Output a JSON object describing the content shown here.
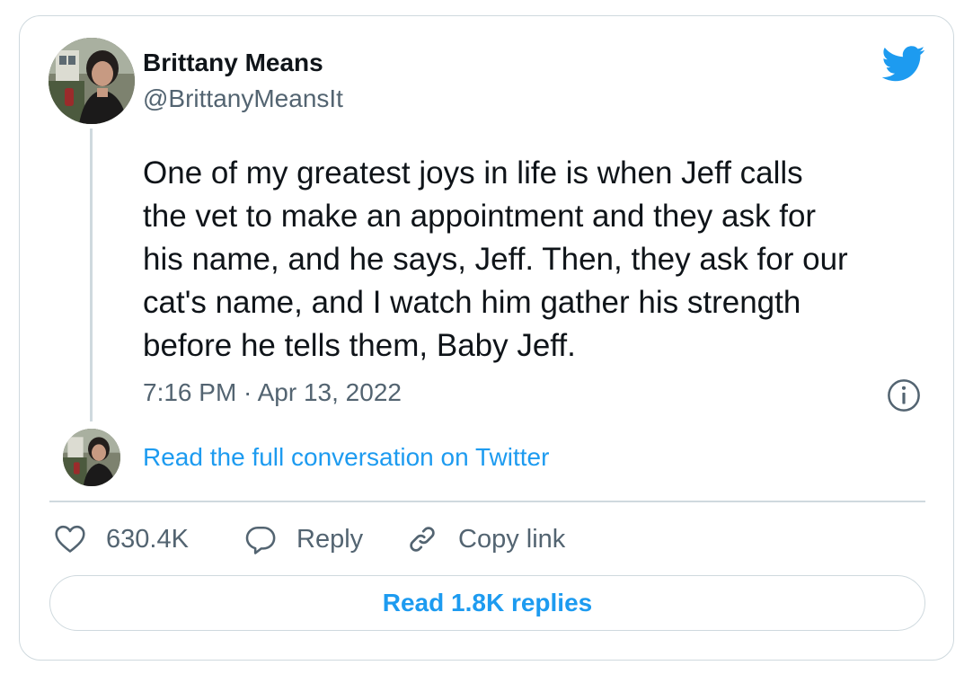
{
  "author": {
    "display_name": "Brittany Means",
    "handle": "@BrittanyMeansIt"
  },
  "tweet": {
    "lines": [
      "One of my greatest joys in life is when Jeff calls",
      "the vet to make an appointment and they ask for",
      "his name, and he says, Jeff. Then, they ask for our",
      "cat's name, and I watch him gather his strength",
      "before he tells them, Baby Jeff."
    ],
    "timestamp": "7:16 PM · Apr 13, 2022"
  },
  "conversation_link": "Read the full conversation on Twitter",
  "actions": {
    "like_count": "630.4K",
    "reply_label": "Reply",
    "copy_link_label": "Copy link"
  },
  "replies_button_label": "Read 1.8K replies",
  "icons": {
    "logo": "twitter-bird-icon",
    "info": "info-icon",
    "like": "heart-icon",
    "reply": "speech-bubble-icon",
    "copy": "link-icon"
  },
  "colors": {
    "accent": "#1d9bf0",
    "text_primary": "#0f1419",
    "text_secondary": "#536471",
    "border": "#cfd9de"
  }
}
